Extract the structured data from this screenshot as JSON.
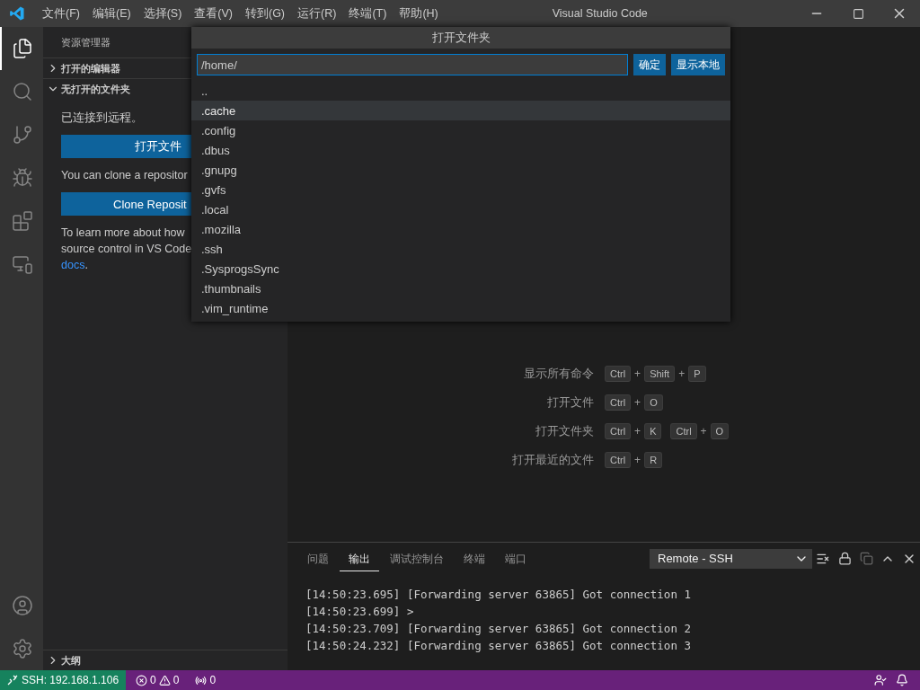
{
  "window": {
    "title": "Visual Studio Code"
  },
  "menu": [
    "文件(F)",
    "编辑(E)",
    "选择(S)",
    "查看(V)",
    "转到(G)",
    "运行(R)",
    "终端(T)",
    "帮助(H)"
  ],
  "activity_bar": [
    {
      "kind": "files",
      "selected": true
    },
    {
      "kind": "search",
      "selected": false
    },
    {
      "kind": "source-control",
      "selected": false
    },
    {
      "kind": "run",
      "selected": false
    },
    {
      "kind": "extensions",
      "selected": false
    },
    {
      "kind": "remote",
      "selected": false
    }
  ],
  "activity_bottom": [
    {
      "kind": "account"
    },
    {
      "kind": "settings"
    }
  ],
  "sidebar": {
    "title": "资源管理器",
    "sections": [
      {
        "label": "打开的编辑器",
        "expanded": false
      },
      {
        "label": "无打开的文件夹",
        "expanded": true
      }
    ],
    "content": [
      {
        "kind": "text",
        "text": "已连接到远程。"
      },
      {
        "kind": "button",
        "text": "打开文件"
      },
      {
        "kind": "text",
        "text": "You can clone a repositor"
      },
      {
        "kind": "button",
        "text": "Clone Reposit"
      },
      {
        "kind": "text",
        "text": "To learn more about how"
      },
      {
        "kind": "text",
        "text": "source control in VS Code"
      },
      {
        "kind": "link",
        "text": "docs",
        "after": "."
      }
    ],
    "outline": {
      "label": "大纲",
      "expanded": false
    }
  },
  "quick_pick": {
    "title": "打开文件夹",
    "value": "/home/",
    "buttons": [
      "确定",
      "显示本地"
    ],
    "items": [
      {
        "label": "..",
        "selected": false
      },
      {
        "label": ".cache",
        "selected": true
      },
      {
        "label": ".config",
        "selected": false
      },
      {
        "label": ".dbus",
        "selected": false
      },
      {
        "label": ".gnupg",
        "selected": false
      },
      {
        "label": ".gvfs",
        "selected": false
      },
      {
        "label": ".local",
        "selected": false
      },
      {
        "label": ".mozilla",
        "selected": false
      },
      {
        "label": ".ssh",
        "selected": false
      },
      {
        "label": ".SysprogsSync",
        "selected": false
      },
      {
        "label": ".thumbnails",
        "selected": false
      },
      {
        "label": ".vim_runtime",
        "selected": false
      }
    ]
  },
  "shortcuts": [
    {
      "label": "显示所有命令",
      "keys": [
        [
          "Ctrl",
          "+",
          "Shift",
          "+",
          "P"
        ]
      ]
    },
    {
      "label": "打开文件",
      "keys": [
        [
          "Ctrl",
          "+",
          "O"
        ]
      ]
    },
    {
      "label": "打开文件夹",
      "keys": [
        [
          "Ctrl",
          "+",
          "K"
        ],
        [
          "Ctrl",
          "+",
          "O"
        ]
      ]
    },
    {
      "label": "打开最近的文件",
      "keys": [
        [
          "Ctrl",
          "+",
          "R"
        ]
      ]
    }
  ],
  "panel": {
    "tabs": [
      {
        "label": "问题",
        "selected": false
      },
      {
        "label": "输出",
        "selected": true
      },
      {
        "label": "调试控制台",
        "selected": false
      },
      {
        "label": "终端",
        "selected": false
      },
      {
        "label": "端口",
        "selected": false
      }
    ],
    "channel": "Remote - SSH",
    "lines": [
      "[14:50:23.695] [Forwarding server 63865] Got connection 1",
      "[14:50:23.699] >",
      "[14:50:23.709] [Forwarding server 63865] Got connection 2",
      "[14:50:24.232] [Forwarding server 63865] Got connection 3"
    ]
  },
  "status_bar": {
    "remote": "SSH: 192.168.1.106",
    "errors": "0",
    "warnings": "0",
    "ports": "0"
  }
}
